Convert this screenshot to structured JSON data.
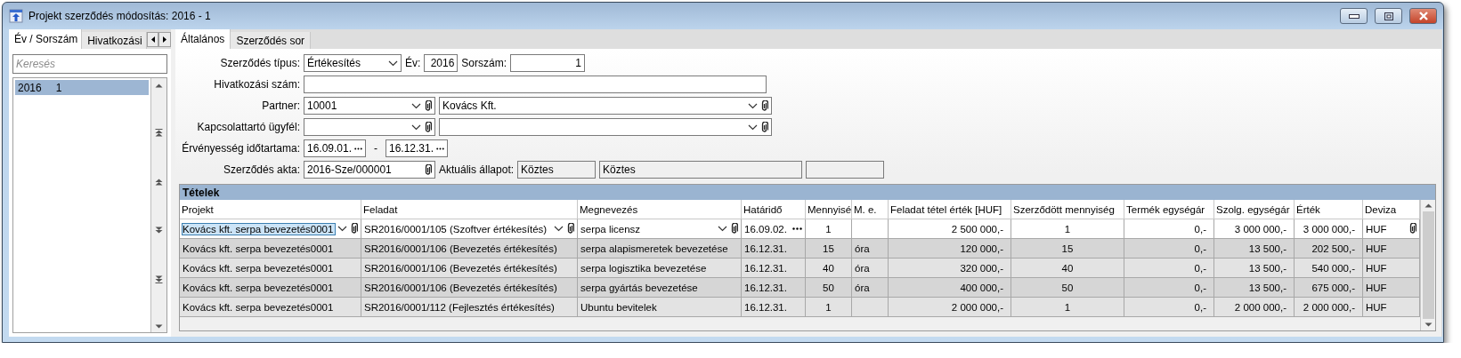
{
  "window": {
    "title": "Projekt szerződés módosítás: 2016 - 1"
  },
  "left_panel": {
    "tabs": [
      {
        "label": "Év / Sorszám",
        "selected": true
      },
      {
        "label": "Hivatkozási",
        "selected": false
      }
    ],
    "search": {
      "placeholder": "Keresés"
    },
    "list": [
      {
        "year": "2016",
        "number": "1",
        "selected": true
      }
    ]
  },
  "tabs": [
    {
      "label": "Általános",
      "selected": true
    },
    {
      "label": "Szerződés sor",
      "selected": false
    }
  ],
  "form": {
    "contract_type": {
      "label": "Szerződés típus:",
      "value": "Értékesítés"
    },
    "year": {
      "label": "Év:",
      "value": "2016"
    },
    "serial": {
      "label": "Sorszám:",
      "value": "1"
    },
    "reference": {
      "label": "Hivatkozási szám:"
    },
    "partner": {
      "label": "Partner:",
      "code": "10001",
      "name": "Kovács Kft."
    },
    "contact": {
      "label": "Kapcsolattartó ügyfél:"
    },
    "validity": {
      "label": "Érvényesség időtartama:",
      "from": "16.09.01.",
      "separator": "-",
      "to": "16.12.31."
    },
    "file": {
      "label": "Szerződés akta:",
      "value": "2016-Sze/000001"
    },
    "status": {
      "label": "Aktuális állapot:",
      "code": "Köztes",
      "name": "Köztes"
    }
  },
  "table": {
    "title": "Tételek",
    "columns": [
      {
        "label": "Projekt",
        "kind": "combo"
      },
      {
        "label": "Feladat",
        "kind": "combo"
      },
      {
        "label": "Megnevezés",
        "kind": "combo"
      },
      {
        "label": "Határidő",
        "kind": "date"
      },
      {
        "label": "Mennyisé",
        "kind": "center"
      },
      {
        "label": "M. e.",
        "kind": "text"
      },
      {
        "label": "Feladat tétel érték [HUF]",
        "kind": "money"
      },
      {
        "label": "Szerződött mennyiség",
        "kind": "center"
      },
      {
        "label": "Termék egységár",
        "kind": "money"
      },
      {
        "label": "Szolg. egységár",
        "kind": "money"
      },
      {
        "label": "Érték",
        "kind": "money"
      },
      {
        "label": "Deviza",
        "kind": "attach"
      }
    ],
    "rows": [
      {
        "selected": true,
        "cells": [
          "Kovács kft. serpa bevezetés0001",
          "SR2016/0001/105 (Szoftver értékesítés)",
          "serpa licensz",
          "16.09.02.",
          "1",
          "",
          "2 500 000,-",
          "1",
          "0,-",
          "3 000 000,-",
          "3 000 000,-",
          "HUF"
        ]
      },
      {
        "selected": false,
        "cells": [
          "Kovács kft. serpa bevezetés0001",
          "SR2016/0001/106 (Bevezetés értékesítés)",
          "serpa alapismeretek bevezetése",
          "16.12.31.",
          "15",
          "óra",
          "120 000,-",
          "15",
          "0,-",
          "13 500,-",
          "202 500,-",
          "HUF"
        ]
      },
      {
        "selected": false,
        "cells": [
          "Kovács kft. serpa bevezetés0001",
          "SR2016/0001/106 (Bevezetés értékesítés)",
          "serpa logisztika bevezetése",
          "16.12.31.",
          "40",
          "óra",
          "320 000,-",
          "40",
          "0,-",
          "13 500,-",
          "540 000,-",
          "HUF"
        ]
      },
      {
        "selected": false,
        "cells": [
          "Kovács kft. serpa bevezetés0001",
          "SR2016/0001/106 (Bevezetés értékesítés)",
          "serpa gyártás bevezetése",
          "16.12.31.",
          "50",
          "óra",
          "400 000,-",
          "50",
          "0,-",
          "13 500,-",
          "675 000,-",
          "HUF"
        ]
      },
      {
        "selected": false,
        "cells": [
          "Kovács kft. serpa bevezetés0001",
          "SR2016/0001/112 (Fejlesztés értékesítés)",
          "Ubuntu bevitelek",
          "16.12.31.",
          "1",
          "",
          "2 000 000,-",
          "1",
          "0,-",
          "2 000 000,-",
          "2 000 000,-",
          "HUF"
        ]
      }
    ]
  }
}
